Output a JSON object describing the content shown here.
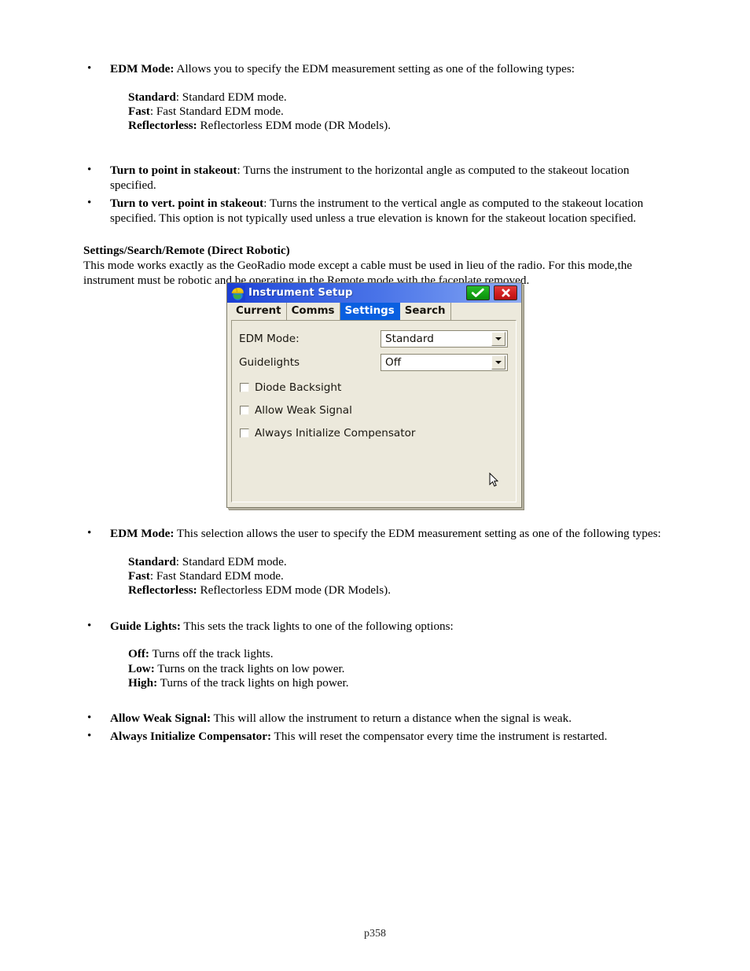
{
  "page": {
    "footer_label": "p358"
  },
  "sections": {
    "top_bullets": [
      {
        "term": "EDM Mode:",
        "rest": " Allows you to specify the EDM measurement setting as one of the following types:"
      }
    ],
    "edm_modes_top": [
      {
        "term": "Standard",
        "rest": ": Standard EDM mode."
      },
      {
        "term": "Fast",
        "rest": ": Fast Standard EDM mode."
      },
      {
        "term": "Reflectorless:",
        "rest": " Reflectorless EDM mode (DR Models)."
      }
    ],
    "turn_bullets": [
      {
        "term": "Turn to point in stakeout",
        "rest": ": Turns the instrument to the horizontal angle as computed to the stakeout location specified."
      },
      {
        "term": "Turn to vert. point in stakeout",
        "rest": ": Turns the instrument to the vertical angle as computed to the stakeout location specified. This option is not typically used unless a true elevation is known for the stakeout location specified."
      }
    ],
    "robotic": {
      "heading": "Settings/Search/Remote (Direct Robotic)",
      "body": "This mode works exactly as the GeoRadio mode except a cable must be used in lieu of the radio.  For this mode,the instrument must be robotic and be operating in the Remote mode with the faceplate removed."
    },
    "bottom_bullets": [
      {
        "term": "EDM Mode:",
        "rest": " This selection allows the user to specify the EDM measurement setting as one of the following types:"
      },
      {
        "term": "Guide Lights:",
        "rest": " This sets the track lights to one of the following options:"
      },
      {
        "term": "Allow Weak Signal:",
        "rest": " This will allow the instrument to return a distance when the signal is weak."
      },
      {
        "term": "Always Initialize Compensator:",
        "rest": " This will reset the compensator every time the instrument is restarted."
      }
    ],
    "edm_modes_bottom": [
      {
        "term": "Standard",
        "rest": ": Standard EDM mode."
      },
      {
        "term": "Fast",
        "rest": ": Fast Standard EDM mode."
      },
      {
        "term": "Reflectorless:",
        "rest": " Reflectorless EDM mode (DR Models)."
      }
    ],
    "guide_light_options": [
      {
        "term": "Off:",
        "rest": " Turns off the track lights."
      },
      {
        "term": "Low:",
        "rest": " Turns on the track lights on low power."
      },
      {
        "term": "High:",
        "rest": " Turns of the track lights on high power."
      }
    ]
  },
  "dialog": {
    "title": "Instrument Setup",
    "title_icon": "hardhat-globe-icon",
    "ok_icon": "check-icon",
    "close_icon": "close-icon",
    "cursor_icon": "mouse-pointer-icon",
    "tabs": [
      {
        "label": "Current",
        "selected": false
      },
      {
        "label": "Comms",
        "selected": false
      },
      {
        "label": "Settings",
        "selected": true
      },
      {
        "label": "Search",
        "selected": false
      }
    ],
    "fields": [
      {
        "label": "EDM Mode:",
        "value": "Standard",
        "options": [
          "Standard",
          "Fast",
          "Reflectorless"
        ]
      },
      {
        "label": "Guidelights",
        "value": "Off",
        "options": [
          "Off",
          "Low",
          "High"
        ]
      }
    ],
    "checkboxes": [
      {
        "label": "Diode Backsight",
        "checked": false
      },
      {
        "label": "Allow Weak Signal",
        "checked": false
      },
      {
        "label": "Always Initialize Compensator",
        "checked": false
      }
    ],
    "colors": {
      "titlebar_start": "#1b3fd4",
      "titlebar_end": "#8fabf3",
      "body": "#ece9dc",
      "selected_tab": "#0a5fe0",
      "ok_button": "#13a213",
      "close_button": "#cf1c1c"
    }
  }
}
